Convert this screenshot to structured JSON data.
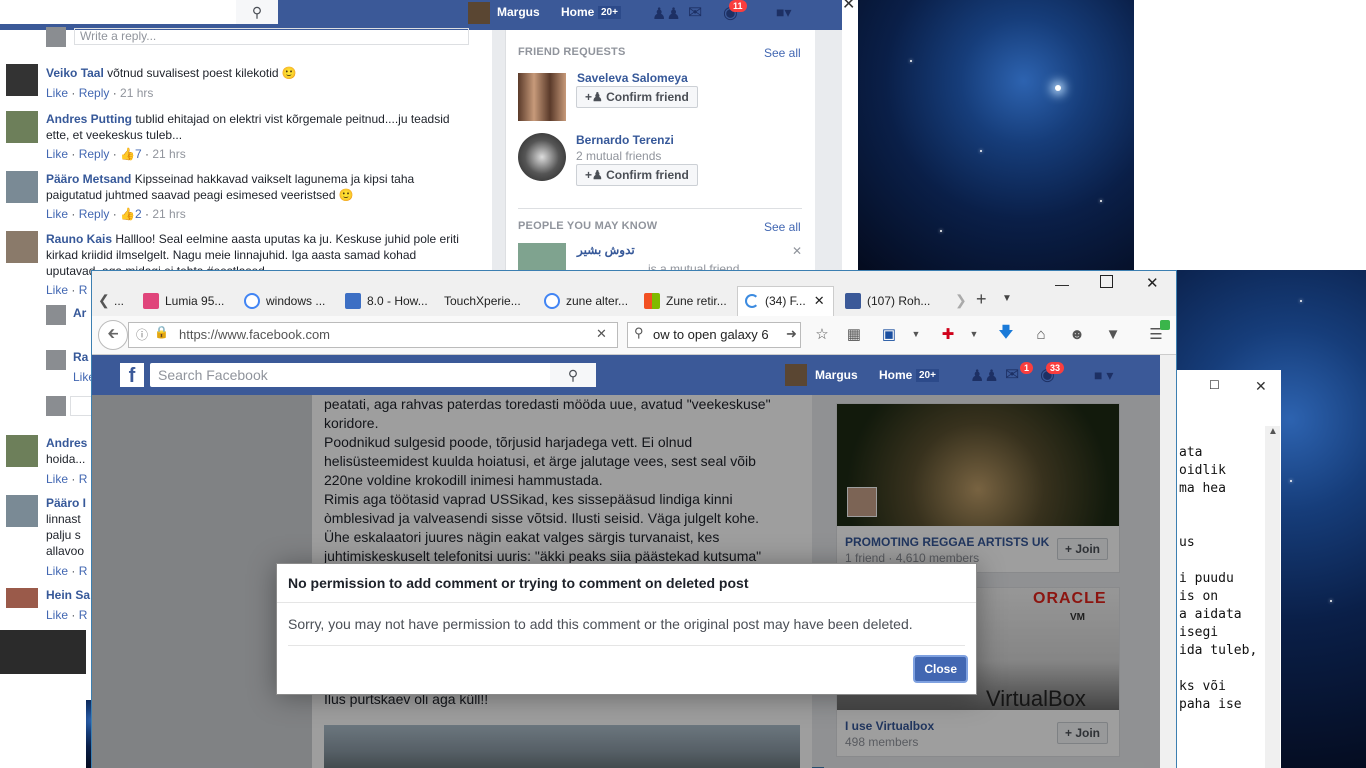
{
  "bg_facebook": {
    "user_name": "Margus",
    "home_label": "Home",
    "home_count": "20+",
    "notif_count": "11",
    "write_reply_placeholder": "Write a reply...",
    "comments": [
      {
        "name": "Veiko Taal",
        "text": "võtnud suvalisest poest kilekotid 🙂",
        "like": "Like",
        "reply": "Reply",
        "likes": "",
        "time": "21 hrs"
      },
      {
        "name": "Andres Putting",
        "text": "tublid ehitajad on elektri vist kõrgemale peitnud....ju teadsid",
        "text2": "ette, et veekeskus tuleb...",
        "like": "Like",
        "reply": "Reply",
        "likes": "7",
        "time": "21 hrs"
      },
      {
        "name": "Pääro Metsand",
        "text": "Kipsseinad hakkavad vaikselt lagunema ja kipsi taha",
        "text2": "paigutatud juhtmed saavad peagi esimesed veeristsed 🙂",
        "like": "Like",
        "reply": "Reply",
        "likes": "2",
        "time": "21 hrs"
      },
      {
        "name": "Rauno Kais",
        "text": "Hallloo! Seal eelmine aasta uputas ka ju. Keskuse juhid pole eriti",
        "text2": "kirkad kriidid ilmselgelt. Nagu meie linnajuhid. Iga aasta samad kohad",
        "text3": "uputavad, aga midagi ei tehta #eestlased",
        "like": "Like",
        "reply": "R",
        "likes": "",
        "time": ""
      }
    ],
    "partial_names": [
      "Ar",
      "Ra",
      "Andres",
      "Pääro I",
      "Hein Sa"
    ],
    "partial_texts": [
      "hoida...",
      "linnast",
      "palju s",
      "allavoo"
    ],
    "like_short": "Like",
    "reply_short": "R",
    "friend_requests_title": "FRIEND REQUESTS",
    "see_all": "See all",
    "requests": [
      {
        "name": "Saveleva Salomeya",
        "sub": "",
        "button": "Confirm friend"
      },
      {
        "name": "Bernardo Terenzi",
        "sub": "2 mutual friends",
        "button": "Confirm friend"
      }
    ],
    "people_title": "PEOPLE YOU MAY KNOW",
    "people_name": "تدوش بشير",
    "people_sub": "is a mutual friend"
  },
  "firefox": {
    "tabs": [
      {
        "label": "...",
        "color": "#888"
      },
      {
        "label": "Lumia 95...",
        "color": "#e0457b"
      },
      {
        "label": "windows ...",
        "color": "#4285f4"
      },
      {
        "label": "8.0 - How...",
        "color": "#3d6fc4"
      },
      {
        "label": "TouchXperie...",
        "color": "#ffffff"
      },
      {
        "label": "zune alter...",
        "color": "#4285f4"
      },
      {
        "label": "Zune retir...",
        "color": "#f25022"
      },
      {
        "label": "(34) F...",
        "color": "#3b5998"
      },
      {
        "label": "(107) Roh...",
        "color": "#3b5998"
      }
    ],
    "url": "https://www.facebook.com",
    "url_domain": "facebook.com",
    "search_value": "ow to open galaxy 6",
    "search_placeholder": "Search Facebook",
    "user_name": "Margus",
    "home_label": "Home",
    "home_count": "20+",
    "msg_count": "1",
    "notif_count": "33",
    "post_lines": [
      "peatati, aga rahvas paterdas toredasti mööda uue, avatud \"veekeskuse\"",
      "koridore.",
      "Poodnikud sulgesid poode, tõrjusid harjadega vett. Ei olnud",
      "helisüsteemidest kuulda hoiatusi, et ärge jalutage vees, sest seal võib",
      "220ne voldine krokodill inimesi hammustada.",
      "Rimis aga töötasid vaprad USSikad, kes sissepääsud lindiga kinni",
      "òmblesivad ja valveasendi sisse võtsid. Ilusti seisid. Väga julgelt kohe.",
      "Ühe eskalaatori juures nägin eakat valges särgis turvanaist, kes",
      "juhtimiskeskuselt telefonitsi uuris: \"äkki peaks siia päästekad kutsuma\""
    ],
    "post_last": "Ilus purtskaev oli aga küll!!",
    "groups": [
      {
        "name": "PROMOTING REGGAE ARTISTS UK",
        "meta": "1 friend · 4,610 members",
        "join": "+ Join"
      },
      {
        "name": "I use Virtualbox",
        "meta": "498 members",
        "join": "+ Join",
        "brand": "ORACLE",
        "brand_sub": "VM",
        "product": "VirtualBox"
      }
    ]
  },
  "modal": {
    "title": "No permission to add comment or trying to comment on deleted post",
    "body": "Sorry, you may not have permission to add this comment or the original post may have been deleted.",
    "close": "Close"
  },
  "notepad": {
    "lines": [
      "",
      "ata",
      "oidlik",
      "ma hea",
      "",
      "",
      "us",
      "",
      "i puudu",
      "is on",
      "a aidata",
      " isegi",
      "ida tuleb,",
      "",
      "ks või",
      " paha ise"
    ]
  },
  "colors": {
    "fb_blue": "#3b5998",
    "link": "#365899",
    "firefox_chrome": "#f0f0f0"
  }
}
